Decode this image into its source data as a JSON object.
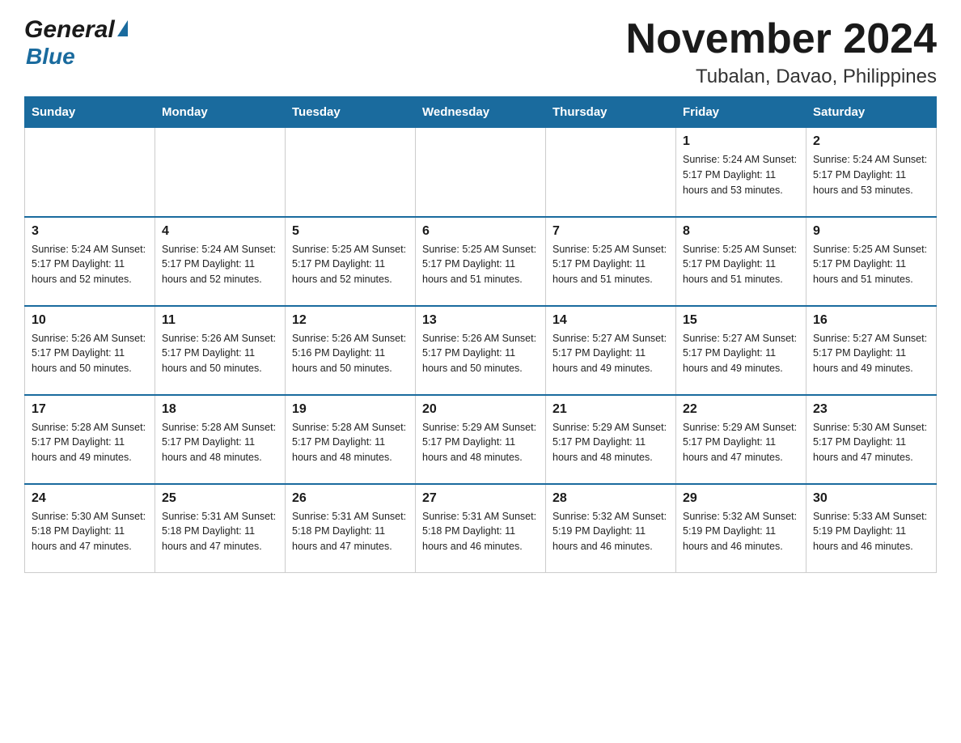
{
  "header": {
    "logo_general": "General",
    "logo_blue": "Blue",
    "month_title": "November 2024",
    "location": "Tubalan, Davao, Philippines"
  },
  "days_of_week": [
    "Sunday",
    "Monday",
    "Tuesday",
    "Wednesday",
    "Thursday",
    "Friday",
    "Saturday"
  ],
  "weeks": [
    {
      "days": [
        {
          "number": "",
          "info": ""
        },
        {
          "number": "",
          "info": ""
        },
        {
          "number": "",
          "info": ""
        },
        {
          "number": "",
          "info": ""
        },
        {
          "number": "",
          "info": ""
        },
        {
          "number": "1",
          "info": "Sunrise: 5:24 AM\nSunset: 5:17 PM\nDaylight: 11 hours\nand 53 minutes."
        },
        {
          "number": "2",
          "info": "Sunrise: 5:24 AM\nSunset: 5:17 PM\nDaylight: 11 hours\nand 53 minutes."
        }
      ]
    },
    {
      "days": [
        {
          "number": "3",
          "info": "Sunrise: 5:24 AM\nSunset: 5:17 PM\nDaylight: 11 hours\nand 52 minutes."
        },
        {
          "number": "4",
          "info": "Sunrise: 5:24 AM\nSunset: 5:17 PM\nDaylight: 11 hours\nand 52 minutes."
        },
        {
          "number": "5",
          "info": "Sunrise: 5:25 AM\nSunset: 5:17 PM\nDaylight: 11 hours\nand 52 minutes."
        },
        {
          "number": "6",
          "info": "Sunrise: 5:25 AM\nSunset: 5:17 PM\nDaylight: 11 hours\nand 51 minutes."
        },
        {
          "number": "7",
          "info": "Sunrise: 5:25 AM\nSunset: 5:17 PM\nDaylight: 11 hours\nand 51 minutes."
        },
        {
          "number": "8",
          "info": "Sunrise: 5:25 AM\nSunset: 5:17 PM\nDaylight: 11 hours\nand 51 minutes."
        },
        {
          "number": "9",
          "info": "Sunrise: 5:25 AM\nSunset: 5:17 PM\nDaylight: 11 hours\nand 51 minutes."
        }
      ]
    },
    {
      "days": [
        {
          "number": "10",
          "info": "Sunrise: 5:26 AM\nSunset: 5:17 PM\nDaylight: 11 hours\nand 50 minutes."
        },
        {
          "number": "11",
          "info": "Sunrise: 5:26 AM\nSunset: 5:17 PM\nDaylight: 11 hours\nand 50 minutes."
        },
        {
          "number": "12",
          "info": "Sunrise: 5:26 AM\nSunset: 5:16 PM\nDaylight: 11 hours\nand 50 minutes."
        },
        {
          "number": "13",
          "info": "Sunrise: 5:26 AM\nSunset: 5:17 PM\nDaylight: 11 hours\nand 50 minutes."
        },
        {
          "number": "14",
          "info": "Sunrise: 5:27 AM\nSunset: 5:17 PM\nDaylight: 11 hours\nand 49 minutes."
        },
        {
          "number": "15",
          "info": "Sunrise: 5:27 AM\nSunset: 5:17 PM\nDaylight: 11 hours\nand 49 minutes."
        },
        {
          "number": "16",
          "info": "Sunrise: 5:27 AM\nSunset: 5:17 PM\nDaylight: 11 hours\nand 49 minutes."
        }
      ]
    },
    {
      "days": [
        {
          "number": "17",
          "info": "Sunrise: 5:28 AM\nSunset: 5:17 PM\nDaylight: 11 hours\nand 49 minutes."
        },
        {
          "number": "18",
          "info": "Sunrise: 5:28 AM\nSunset: 5:17 PM\nDaylight: 11 hours\nand 48 minutes."
        },
        {
          "number": "19",
          "info": "Sunrise: 5:28 AM\nSunset: 5:17 PM\nDaylight: 11 hours\nand 48 minutes."
        },
        {
          "number": "20",
          "info": "Sunrise: 5:29 AM\nSunset: 5:17 PM\nDaylight: 11 hours\nand 48 minutes."
        },
        {
          "number": "21",
          "info": "Sunrise: 5:29 AM\nSunset: 5:17 PM\nDaylight: 11 hours\nand 48 minutes."
        },
        {
          "number": "22",
          "info": "Sunrise: 5:29 AM\nSunset: 5:17 PM\nDaylight: 11 hours\nand 47 minutes."
        },
        {
          "number": "23",
          "info": "Sunrise: 5:30 AM\nSunset: 5:17 PM\nDaylight: 11 hours\nand 47 minutes."
        }
      ]
    },
    {
      "days": [
        {
          "number": "24",
          "info": "Sunrise: 5:30 AM\nSunset: 5:18 PM\nDaylight: 11 hours\nand 47 minutes."
        },
        {
          "number": "25",
          "info": "Sunrise: 5:31 AM\nSunset: 5:18 PM\nDaylight: 11 hours\nand 47 minutes."
        },
        {
          "number": "26",
          "info": "Sunrise: 5:31 AM\nSunset: 5:18 PM\nDaylight: 11 hours\nand 47 minutes."
        },
        {
          "number": "27",
          "info": "Sunrise: 5:31 AM\nSunset: 5:18 PM\nDaylight: 11 hours\nand 46 minutes."
        },
        {
          "number": "28",
          "info": "Sunrise: 5:32 AM\nSunset: 5:19 PM\nDaylight: 11 hours\nand 46 minutes."
        },
        {
          "number": "29",
          "info": "Sunrise: 5:32 AM\nSunset: 5:19 PM\nDaylight: 11 hours\nand 46 minutes."
        },
        {
          "number": "30",
          "info": "Sunrise: 5:33 AM\nSunset: 5:19 PM\nDaylight: 11 hours\nand 46 minutes."
        }
      ]
    }
  ]
}
